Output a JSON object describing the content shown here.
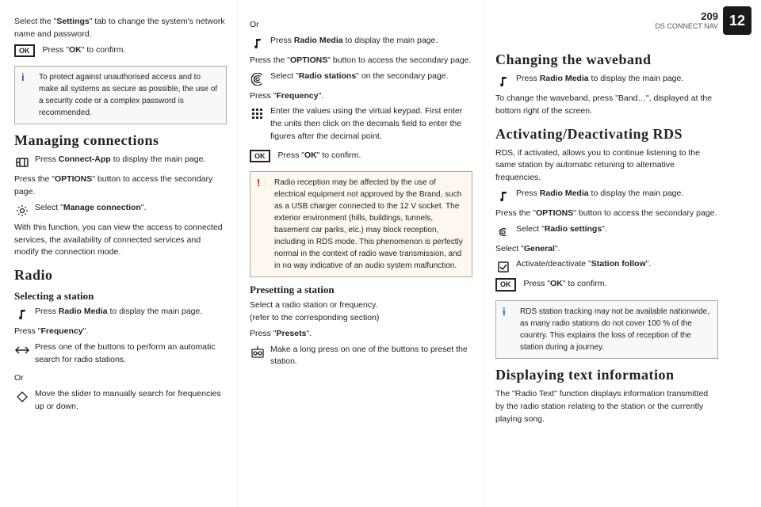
{
  "page": {
    "number": "209",
    "chapter_label": "DS CONNECT NAV",
    "chapter_number": "12"
  },
  "left_col": {
    "intro_text_1": "Select the \"",
    "intro_bold_1": "Settings",
    "intro_text_2": "\" tab to change the system's network name and password.",
    "ok_press": "Press \"",
    "ok_bold": "OK",
    "ok_end": "\" to confirm.",
    "info_box": {
      "text": "To protect against unauthorised access and to make all systems as secure as possible, the use of a security code or a complex password is recommended."
    },
    "managing_connections": {
      "heading": "Managing connections",
      "step1_pre": "Press ",
      "step1_bold": "Connect-App",
      "step1_post": " to display the main page.",
      "step2_pre": "Press the \"",
      "step2_bold": "OPTIONS",
      "step2_post": "\" button to access the secondary page.",
      "step3_pre": "Select \"",
      "step3_bold": "Manage connection",
      "step3_post": "\".",
      "description": "With this function, you can view the access to connected services, the availability of connected services and modify the connection mode."
    },
    "radio": {
      "heading": "Radio",
      "sub_heading": "Selecting a station",
      "step1_pre": "Press ",
      "step1_bold": "Radio Media",
      "step1_post": " to display the main page.",
      "step2_pre": "Press \"",
      "step2_bold": "Frequency",
      "step2_post": "\".",
      "step3_text": "Press one of the buttons to perform an automatic search for radio stations.",
      "or_text": "Or",
      "step4_text": "Move the slider to manually search for frequencies up or down."
    }
  },
  "mid_col": {
    "or_text": "Or",
    "step_radio_media_pre": "Press ",
    "step_radio_media_bold": "Radio Media",
    "step_radio_media_post": " to display the main page.",
    "step_options_pre": "Press the \"",
    "step_options_bold": "OPTIONS",
    "step_options_post": "\" button to access the secondary page.",
    "step_radio_stations_pre": "Select \"",
    "step_radio_stations_bold": "Radio stations",
    "step_radio_stations_post": "\" on the secondary page.",
    "step_frequency_pre": "Press \"",
    "step_frequency_bold": "Frequency",
    "step_frequency_post": "\".",
    "step_keypad": "Enter the values using the virtual keypad. First enter the units then click on the decimals field to enter the figures after the decimal point.",
    "step_ok_pre": "Press \"",
    "step_ok_bold": "OK",
    "step_ok_post": "\" to confirm.",
    "warning_box": {
      "text": "Radio reception may be affected by the use of electrical equipment not approved by the Brand, such as a USB charger connected to the 12 V socket. The exterior environment (hills, buildings, tunnels, basement car parks, etc.) may block reception, including in RDS mode. This phenomenon is perfectly normal in the context of radio wave transmission, and in no way indicative of an audio system malfunction."
    },
    "presetting_heading": "Presetting a station",
    "presetting_desc": "Select a radio station or frequency.\n(refer to the corresponding section)",
    "presetting_step_pre": "Press \"",
    "presetting_step_bold": "Presets",
    "presetting_step_post": "\".",
    "presetting_long_press": "Make a long press on one of the buttons to preset the station."
  },
  "right_col": {
    "changing_waveband": {
      "heading": "Changing the waveband",
      "step_pre": "Press ",
      "step_bold": "Radio Media",
      "step_post": " to display the main page.",
      "desc": "To change the waveband, press \"Band…\", displayed at the bottom right of the screen."
    },
    "activating_rds": {
      "heading": "Activating/Deactivating RDS",
      "desc": "RDS, if activated, allows you to continue listening to the same station by automatic retuning to alternative frequencies.",
      "step1_pre": "Press ",
      "step1_bold": "Radio Media",
      "step1_post": " to display the main page.",
      "step2_pre": "Press the \"",
      "step2_bold": "OPTIONS",
      "step2_post": "\" button to access the secondary page.",
      "step3_pre": "Select \"",
      "step3_bold": "Radio settings",
      "step3_post": "\".",
      "step4_pre": "Select \"",
      "step4_bold": "General",
      "step4_post": "\".",
      "step5_pre": "Activate/deactivate \"",
      "step5_bold": "Station follow",
      "step5_post": "\".",
      "step6_pre": "Press \"",
      "step6_bold": "OK",
      "step6_post": "\" to confirm.",
      "info_box": {
        "text": "RDS station tracking may not be available nationwide, as many radio stations do not cover 100 % of the country. This explains the loss of reception of the station during a journey."
      }
    },
    "displaying_text": {
      "heading": "Displaying text information",
      "desc": "The \"Radio Text\" function displays information transmitted by the radio station relating to the station or the currently playing song."
    }
  }
}
